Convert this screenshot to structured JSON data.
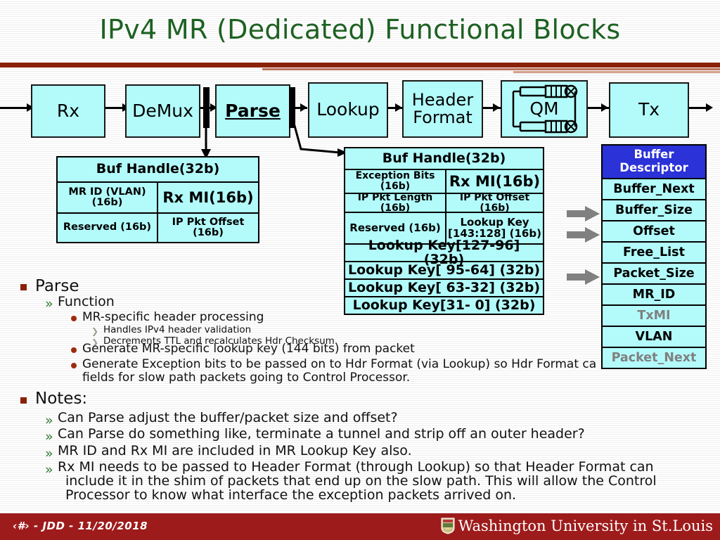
{
  "title": "IPv4 MR (Dedicated) Functional Blocks",
  "colors": {
    "title_green": "#1d6122",
    "rule_dark_red": "#8a2208",
    "block_cyan": "#b3fbfb",
    "descriptor_blue": "#2b32d8",
    "footer_red": "#9e1b1b",
    "dim_gray": "#808080",
    "bullet_square": "#8a2208",
    "bullet_chevron_green": "#2f7a33",
    "bullet_dot_red": "#9c2c10",
    "gray_arrow": "#808080"
  },
  "flow": {
    "blocks": [
      {
        "id": "rx",
        "label": "Rx"
      },
      {
        "id": "demux",
        "label": "DeMux"
      },
      {
        "id": "parse",
        "label": "Parse"
      },
      {
        "id": "lookup",
        "label": "Lookup"
      },
      {
        "id": "hdrformat",
        "label": "Header\nFormat"
      },
      {
        "id": "qm",
        "label": "QM"
      },
      {
        "id": "tx",
        "label": "Tx"
      }
    ],
    "hdr_format_line1": "Header",
    "hdr_format_line2": "Format"
  },
  "left_table": {
    "title": "Buf Handle(32b)",
    "rows": [
      [
        "MR ID (VLAN) (16b)",
        "Rx MI(16b)"
      ],
      [
        "Reserved (16b)",
        "IP Pkt Offset (16b)"
      ]
    ]
  },
  "mid_table": {
    "title": "Buf Handle(32b)",
    "split_rows": [
      [
        "Exception Bits (16b)",
        "Rx MI(16b)"
      ],
      [
        "IP Pkt Length (16b)",
        "IP Pkt Offset (16b)"
      ],
      [
        "Reserved (16b)",
        "Lookup Key\n[143:128] (16b)"
      ]
    ],
    "row3_right_line1": "Lookup Key",
    "row3_right_line2": "[143:128] (16b)",
    "full_rows": [
      "Lookup Key[127-96] (32b)",
      "Lookup Key[ 95-64] (32b)",
      "Lookup Key[ 63-32] (32b)",
      "Lookup Key[31-  0] (32b)"
    ]
  },
  "right_table": {
    "header_line1": "Buffer",
    "header_line2": "Descriptor",
    "rows": [
      {
        "label": "Buffer_Next",
        "dim": false,
        "arrow": false
      },
      {
        "label": "Buffer_Size",
        "dim": false,
        "arrow": true
      },
      {
        "label": "Offset",
        "dim": false,
        "arrow": true
      },
      {
        "label": "Free_List",
        "dim": false,
        "arrow": false
      },
      {
        "label": "Packet_Size",
        "dim": false,
        "arrow": true
      },
      {
        "label": "MR_ID",
        "dim": false,
        "arrow": false
      },
      {
        "label": "TxMI",
        "dim": true,
        "arrow": false
      },
      {
        "label": "VLAN",
        "dim": false,
        "arrow": false
      },
      {
        "label": "Packet_Next",
        "dim": true,
        "arrow": false
      }
    ]
  },
  "bullets": {
    "parse_heading": "Parse",
    "function_heading": "Function",
    "b1": "MR-specific header processing",
    "b1a": "Handles IPv4 header validation",
    "b1b": "Decrements TTL and recalculates Hdr Checksum.",
    "b2": "Generate MR-specific lookup key (144 bits) from packet",
    "b3_line1": "Generate Exception bits to be passed on to Hdr Format (via Lookup) so Hdr Format ca",
    "b3_line2": "fields for slow path packets going to Control Processor.",
    "notes_heading": "Notes:",
    "n1": "Can Parse adjust the buffer/packet size and offset?",
    "n2": "Can Parse do something like, terminate a tunnel and strip off an outer header?",
    "n3": "MR ID and Rx MI are included in MR Lookup Key also.",
    "n4_line1": "Rx MI needs to be passed to Header Format (through Lookup) so that Header Format can",
    "n4_line2": "include it in the shim of packets that end up on the slow path. This will allow the Control",
    "n4_line3": "Processor to know what interface the exception packets arrived on."
  },
  "footer": {
    "left_text": "‹#› - JDD - 11/20/2018",
    "logo_text": "Washington University in St.Louis"
  }
}
